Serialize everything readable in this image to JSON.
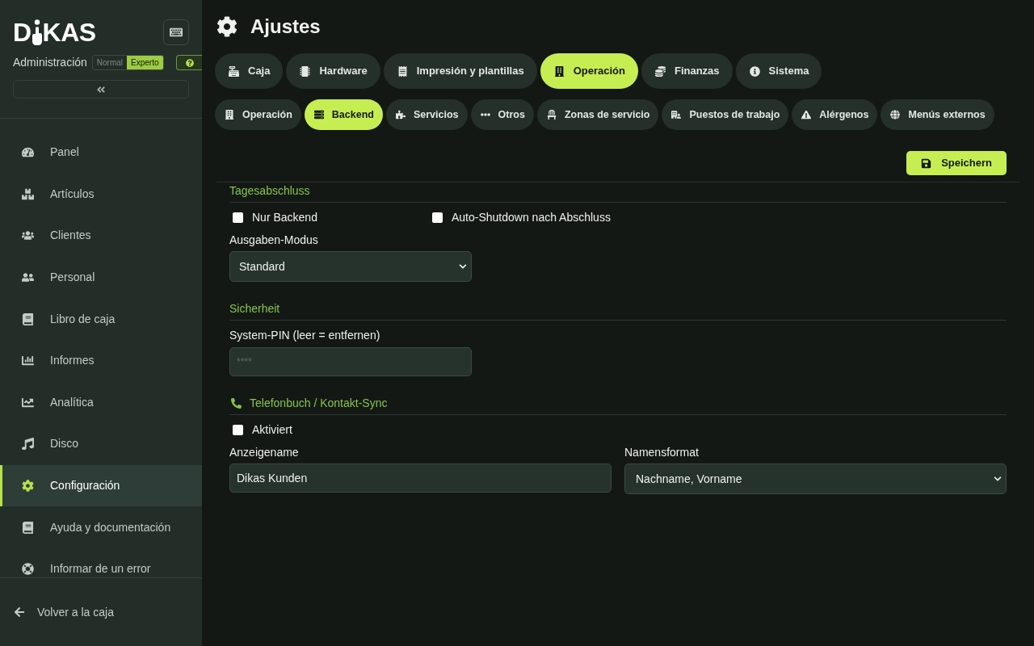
{
  "sidebar": {
    "logo": {
      "left": "D",
      "right": "KAS"
    },
    "subtitle": "Administración",
    "mode_toggle": [
      {
        "label": "Normal",
        "selected": false
      },
      {
        "label": "Experto",
        "selected": true
      }
    ],
    "nav_items": [
      {
        "label": "Panel",
        "selected": false
      },
      {
        "label": "Artículos",
        "selected": false
      },
      {
        "label": "Clientes",
        "selected": false
      },
      {
        "label": "Personal",
        "selected": false
      },
      {
        "label": "Libro de caja",
        "selected": false
      },
      {
        "label": "Informes",
        "selected": false
      },
      {
        "label": "Analítica",
        "selected": false
      },
      {
        "label": "Disco",
        "selected": false
      },
      {
        "label": "Configuración",
        "selected": true
      },
      {
        "label": "Ayuda y documentación",
        "selected": false
      },
      {
        "label": "Informar de un error",
        "selected": false
      }
    ],
    "footer_link": "Volver a la caja"
  },
  "header": {
    "title": "Ajustes"
  },
  "tabs": [
    {
      "label": "Caja",
      "selected": false
    },
    {
      "label": "Hardware",
      "selected": false
    },
    {
      "label": "Impresión y plantillas",
      "selected": false
    },
    {
      "label": "Operación",
      "selected": true
    },
    {
      "label": "Finanzas",
      "selected": false
    },
    {
      "label": "Sistema",
      "selected": false
    }
  ],
  "subtabs": [
    {
      "label": "Operación",
      "selected": false
    },
    {
      "label": "Backend",
      "selected": true
    },
    {
      "label": "Servicios",
      "selected": false
    },
    {
      "label": "Otros",
      "selected": false
    },
    {
      "label": "Zonas de servicio",
      "selected": false
    },
    {
      "label": "Puestos de trabajo",
      "selected": false
    },
    {
      "label": "Alérgenos",
      "selected": false
    },
    {
      "label": "Menús externos",
      "selected": false
    }
  ],
  "save_button": "Speichern",
  "day_close": {
    "title": "Tagesabschluss",
    "checkboxes": [
      {
        "label": "Nur Backend",
        "checked": false
      },
      {
        "label": "Auto-Shutdown nach Abschluss",
        "checked": false
      }
    ],
    "select": {
      "label": "Ausgaben-Modus",
      "value": "Standard"
    }
  },
  "security": {
    "title": "Sicherheit",
    "field": {
      "label": "System-PIN (leer = entfernen)",
      "placeholder": "****"
    }
  },
  "phonebook": {
    "title": "Telefonbuch / Kontakt-Sync",
    "checkbox": {
      "label": "Aktiviert",
      "checked": false
    },
    "fields": [
      {
        "kind": "text",
        "label": "Anzeigename",
        "value": "Dikas Kunden"
      },
      {
        "kind": "select",
        "label": "Namensformat",
        "value": "Nachname, Vorname"
      }
    ]
  }
}
